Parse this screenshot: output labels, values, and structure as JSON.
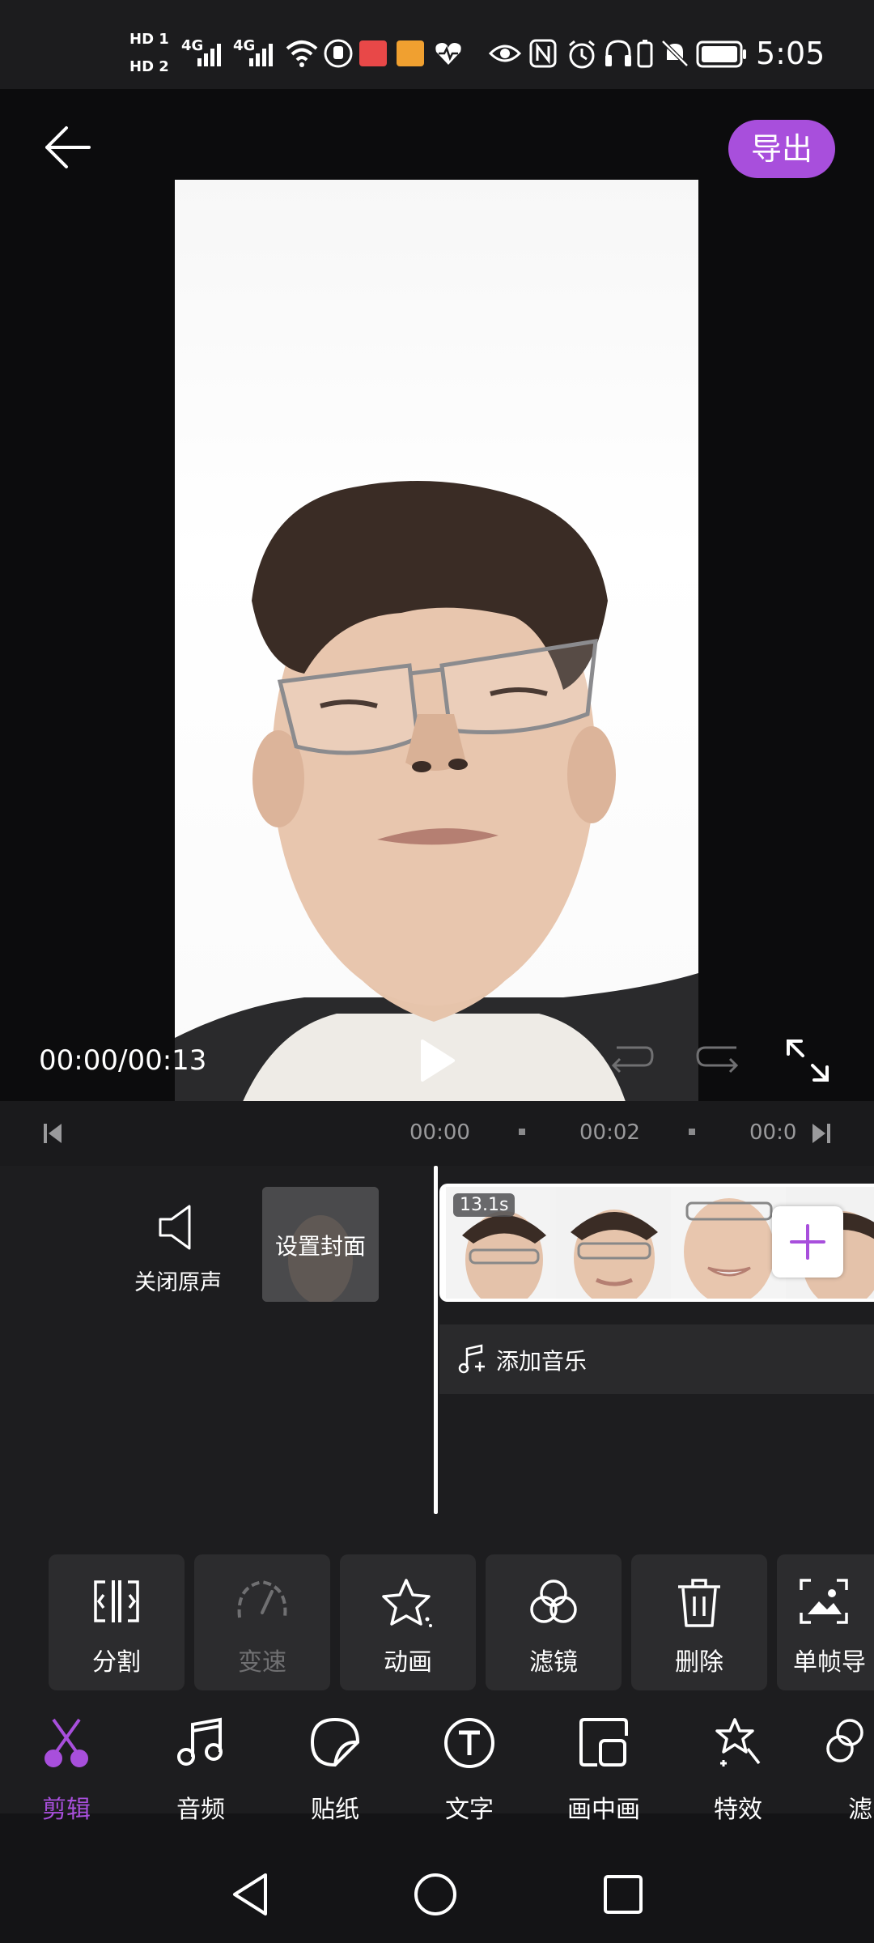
{
  "status_bar": {
    "hd1": "HD 1",
    "hd2": "HD 2",
    "net1": "4G",
    "net2": "4G",
    "time": "5:05"
  },
  "header": {
    "export_label": "导出"
  },
  "player": {
    "time": "00:00/00:13"
  },
  "ruler": {
    "ticks": [
      "00:00",
      "00:02",
      "00:0"
    ]
  },
  "timeline": {
    "mute_label": "关闭原声",
    "cover_label": "设置封面",
    "clip_duration": "13.1s",
    "add_music_label": "添加音乐"
  },
  "tools": [
    {
      "label": "分割",
      "icon": "split-icon"
    },
    {
      "label": "变速",
      "icon": "speedometer-icon"
    },
    {
      "label": "动画",
      "icon": "star-animation-icon"
    },
    {
      "label": "滤镜",
      "icon": "filter-circles-icon"
    },
    {
      "label": "删除",
      "icon": "trash-icon"
    },
    {
      "label": "单帧导",
      "icon": "frame-export-icon"
    }
  ],
  "bottom_nav": [
    {
      "label": "剪辑",
      "icon": "scissors-icon"
    },
    {
      "label": "音频",
      "icon": "music-note-icon"
    },
    {
      "label": "贴纸",
      "icon": "sticker-icon"
    },
    {
      "label": "文字",
      "icon": "text-t-icon"
    },
    {
      "label": "画中画",
      "icon": "picture-in-picture-icon"
    },
    {
      "label": "特效",
      "icon": "magic-star-icon"
    },
    {
      "label": "滤",
      "icon": "filter-icon"
    }
  ],
  "colors": {
    "accent": "#a84fdc",
    "background": "#141416",
    "panel": "#1d1d1f",
    "tool_bg": "#2c2c2e"
  }
}
